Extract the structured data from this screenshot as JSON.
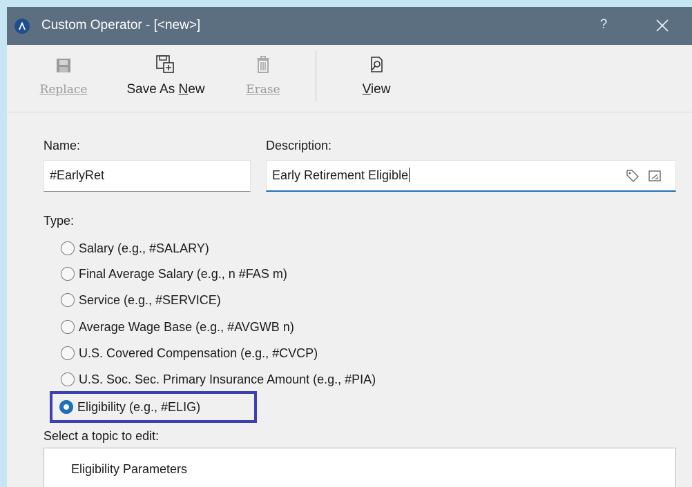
{
  "window": {
    "title": "Custom Operator - [<new>]",
    "help_label": "?"
  },
  "toolbar": {
    "replace": {
      "label": "Replace",
      "enabled": false,
      "icon": "save-icon"
    },
    "save_as_new": {
      "label_prefix": "Save As ",
      "label_mnemonic": "N",
      "label_suffix": "ew",
      "enabled": true,
      "icon": "save-as-new-icon"
    },
    "erase": {
      "label": "Erase",
      "enabled": false,
      "icon": "trash-icon"
    },
    "view": {
      "label_mnemonic": "V",
      "label_suffix": "iew",
      "enabled": true,
      "icon": "view-document-icon"
    }
  },
  "form": {
    "name_label": "Name:",
    "name_value": "#EarlyRet",
    "description_label": "Description:",
    "description_value": "Early Retirement Eligible",
    "description_icons": [
      "tag-icon",
      "note-icon"
    ],
    "type_label": "Type:",
    "type_options": [
      {
        "label": "Salary (e.g., #SALARY)",
        "checked": false
      },
      {
        "label": "Final Average Salary (e.g., n #FAS m)",
        "checked": false
      },
      {
        "label": "Service (e.g., #SERVICE)",
        "checked": false
      },
      {
        "label": "Average Wage Base (e.g., #AVGWB n)",
        "checked": false
      },
      {
        "label": "U.S. Covered Compensation (e.g., #CVCP)",
        "checked": false
      },
      {
        "label": "U.S. Soc. Sec. Primary Insurance Amount (e.g., #PIA)",
        "checked": false
      },
      {
        "label": "Eligibility (e.g., #ELIG)",
        "checked": true
      }
    ],
    "topic_label": "Select a topic to edit:",
    "topics": [
      "Eligibility Parameters"
    ]
  },
  "colors": {
    "titlebar": "#5c6f80",
    "accent": "#1f6fb6",
    "highlight": "#3e3fb0",
    "background": "#f0f0f0",
    "desktop": "#c7e6f3"
  }
}
